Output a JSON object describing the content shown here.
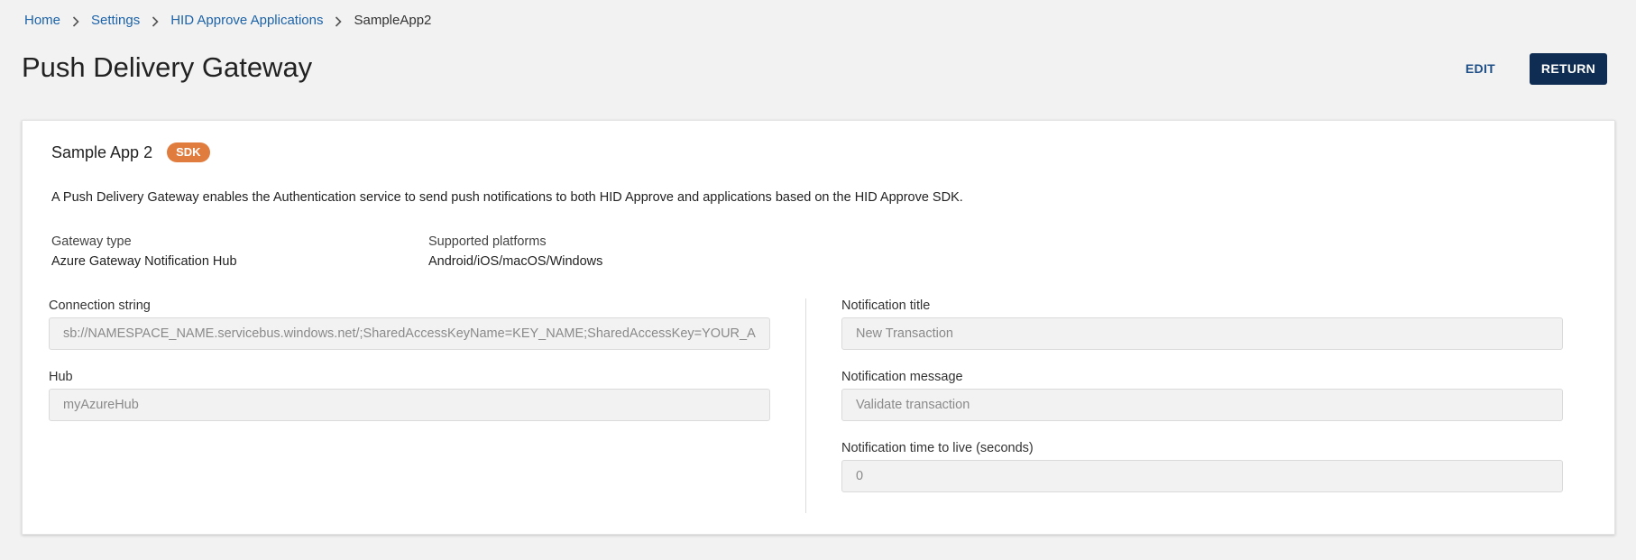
{
  "breadcrumb": {
    "items": [
      {
        "label": "Home"
      },
      {
        "label": "Settings"
      },
      {
        "label": "HID Approve Applications"
      }
    ],
    "current": "SampleApp2"
  },
  "page": {
    "title": "Push Delivery Gateway"
  },
  "actions": {
    "edit_label": "EDIT",
    "return_label": "RETURN"
  },
  "card": {
    "app_name": "Sample App 2",
    "badge": "SDK",
    "description": "A Push Delivery Gateway enables the Authentication service to send push notifications to both HID Approve and applications based on the HID Approve SDK.",
    "gateway_type": {
      "label": "Gateway type",
      "value": "Azure Gateway Notification Hub"
    },
    "supported_platforms": {
      "label": "Supported platforms",
      "value": "Android/iOS/macOS/Windows"
    }
  },
  "fields": {
    "connection_string": {
      "label": "Connection string",
      "value": "sb://NAMESPACE_NAME.servicebus.windows.net/;SharedAccessKeyName=KEY_NAME;SharedAccessKey=YOUR_ACCESS_KEY"
    },
    "hub": {
      "label": "Hub",
      "value": "myAzureHub"
    },
    "notification_title": {
      "label": "Notification title",
      "value": "New Transaction"
    },
    "notification_message": {
      "label": "Notification message",
      "value": "Validate transaction"
    },
    "notification_ttl": {
      "label": "Notification time to live (seconds)",
      "value": "0"
    }
  },
  "colors": {
    "link": "#1d63a8",
    "primary_button": "#0f2d52",
    "badge": "#e07c3e",
    "background": "#f2f2f2"
  }
}
